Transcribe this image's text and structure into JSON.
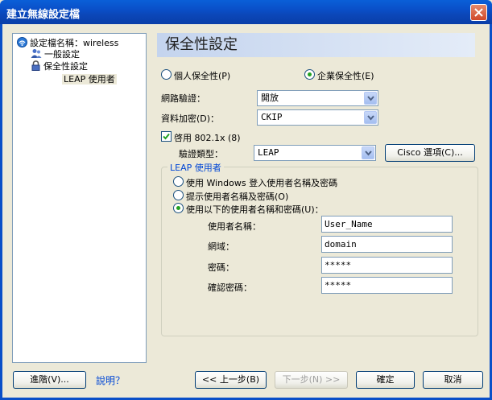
{
  "window": {
    "title": "建立無線設定檔"
  },
  "tree": {
    "profile_label": "設定檔名稱：wireless",
    "items": [
      {
        "label": "一般設定"
      },
      {
        "label": "保全性設定"
      },
      {
        "label": "LEAP 使用者"
      }
    ]
  },
  "main": {
    "title": "保全性設定",
    "personal_security": "個人保全性(P)",
    "enterprise_security": "企業保全性(E)",
    "selected_security": "enterprise",
    "network_auth_label": "網路驗證：",
    "network_auth_value": "開放",
    "data_encryption_label": "資料加密(D)：",
    "data_encryption_value": "CKIP",
    "enable_8021x_label": "啓用 802.1x (8)",
    "enable_8021x_checked": true,
    "auth_type_label": "驗證類型：",
    "auth_type_value": "LEAP",
    "cisco_options_button": "Cisco 選項(C)...",
    "leap_group_title": "LEAP 使用者",
    "leap_options": [
      {
        "label": "使用 Windows 登入使用者名稱及密碼",
        "selected": false
      },
      {
        "label": "提示使用者名稱及密碼(O)",
        "selected": false
      },
      {
        "label": "使用以下的使用者名稱和密碼(U)：",
        "selected": true
      }
    ],
    "username_label": "使用者名稱：",
    "username_value": "User_Name",
    "domain_label": "網域：",
    "domain_value": "domain",
    "password_label": "密碼：",
    "password_value": "*****",
    "confirm_password_label": "確認密碼：",
    "confirm_password_value": "*****"
  },
  "footer": {
    "advanced_button": "進階(V)...",
    "help_link": "說明？",
    "back_button": "<< 上一步(B)",
    "next_button": "下一步(N) >>",
    "ok_button": "確定",
    "cancel_button": "取消"
  },
  "colors": {
    "titlebar": "#0a4fc8",
    "close": "#d0482a",
    "link": "#0046d5"
  }
}
